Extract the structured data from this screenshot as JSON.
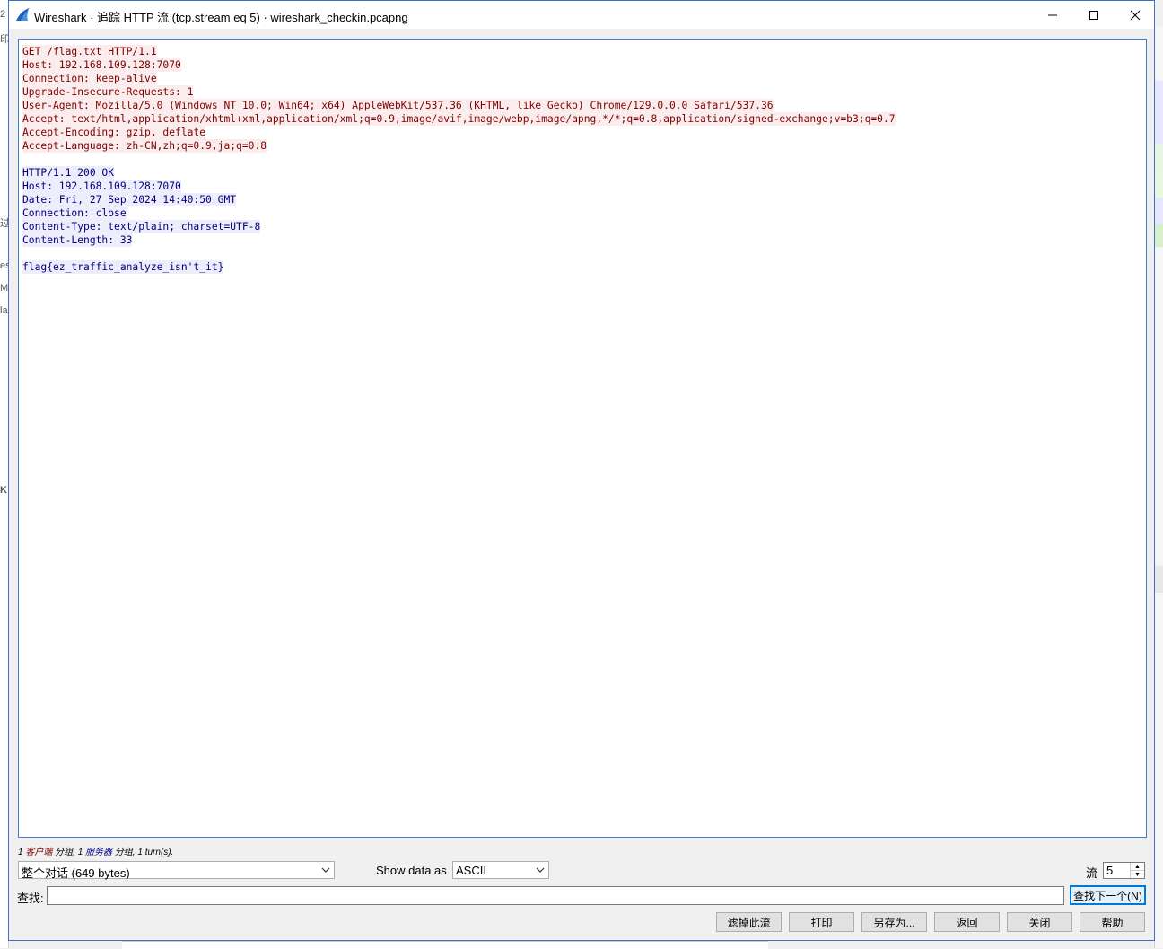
{
  "window": {
    "title": "Wireshark · 追踪 HTTP 流 (tcp.stream eq 5) · wireshark_checkin.pcapng"
  },
  "stream": {
    "client_lines": [
      "GET /flag.txt HTTP/1.1",
      "Host: 192.168.109.128:7070",
      "Connection: keep-alive",
      "Upgrade-Insecure-Requests: 1",
      "User-Agent: Mozilla/5.0 (Windows NT 10.0; Win64; x64) AppleWebKit/537.36 (KHTML, like Gecko) Chrome/129.0.0.0 Safari/537.36",
      "Accept: text/html,application/xhtml+xml,application/xml;q=0.9,image/avif,image/webp,image/apng,*/*;q=0.8,application/signed-exchange;v=b3;q=0.7",
      "Accept-Encoding: gzip, deflate",
      "Accept-Language: zh-CN,zh;q=0.9,ja;q=0.8"
    ],
    "server_lines": [
      "HTTP/1.1 200 OK",
      "Host: 192.168.109.128:7070",
      "Date: Fri, 27 Sep 2024 14:40:50 GMT",
      "Connection: close",
      "Content-Type: text/plain; charset=UTF-8",
      "Content-Length: 33"
    ],
    "body_line": "flag{ez_traffic_analyze_isn't_it}"
  },
  "stats": {
    "client_count": "1",
    "client_label": "客户端",
    "client_suffix": "分组,",
    "server_count": "1",
    "server_label": "服务器",
    "server_suffix": "分组,",
    "turns": "1 turn(s)."
  },
  "controls": {
    "conversation_value": "整个对话 (649 bytes)",
    "show_data_label": "Show data as",
    "show_data_value": "ASCII",
    "stream_label": "流",
    "stream_value": "5",
    "find_label": "查找:",
    "find_value": "",
    "find_next_label": "查找下一个(N)"
  },
  "buttons": {
    "filter_out": "滤掉此流",
    "print": "打印",
    "save_as": "另存为...",
    "back": "返回",
    "close": "关闭",
    "help": "帮助"
  },
  "colors": {
    "client_text": "#7f0000",
    "client_bg": "#fbeded",
    "server_text": "#00007f",
    "server_bg": "#ededfb",
    "accent": "#0078d7"
  }
}
